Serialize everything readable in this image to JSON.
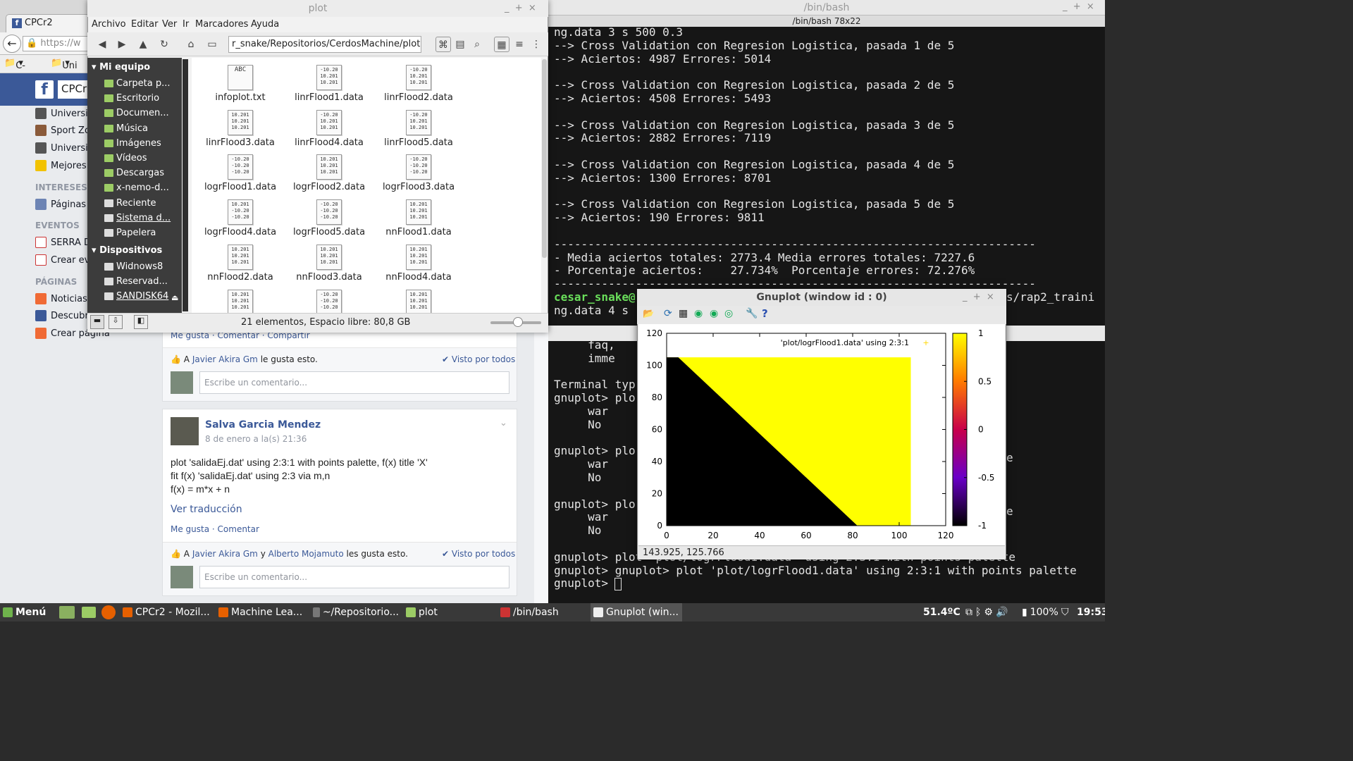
{
  "browser": {
    "tab_title": "CPCr2",
    "url": "https://w",
    "bookmarks": [
      "C-sar",
      "Uni"
    ],
    "fb_search": "CPCr",
    "sidebar": {
      "favs": [
        "Universid",
        "Sport Zor",
        "Universid",
        "Mejores a"
      ],
      "interests_head": "INTERESES",
      "interests": [
        "Páginas y"
      ],
      "events_head": "EVENTOS",
      "events": [
        "SERRA D",
        "Crear eve"
      ],
      "pages_head": "PÁGINAS",
      "pages": [
        "Noticias d",
        "Descubri",
        "Crear página"
      ]
    },
    "post1": {
      "actions": "Me gusta · Comentar · Compartir",
      "likes_prefix": "A",
      "liker": "Javier Akira Gm",
      "likes_suffix": "le gusta esto.",
      "seen": "Visto por todos",
      "comment_placeholder": "Escribe un comentario..."
    },
    "post2": {
      "author": "Salva Garcia Mendez",
      "date": "8 de enero a la(s) 21:36",
      "lines": [
        "plot 'salidaEj.dat' using 2:3:1 with points palette, f(x) title 'X'",
        "fit f(x) 'salidaEj.dat' using 2:3 via m,n",
        "f(x) = m*x + n"
      ],
      "translate": "Ver traducción",
      "actions": "Me gusta · Comentar",
      "likes_prefix": "A",
      "liker1": "Javier Akira Gm",
      "and": "y",
      "liker2": "Alberto Mojamuto",
      "likes_suffix": "les gusta esto.",
      "seen": "Visto por todos",
      "comment_placeholder": "Escribe un comentario..."
    }
  },
  "terminal": {
    "title": "/bin/bash",
    "subtitle": "/bin/bash 78x22",
    "lines": [
      "ng.data 3 s 500 0.3",
      "--> Cross Validation con Regresion Logistica, pasada 1 de 5",
      "--> Aciertos: 4987 Errores: 5014",
      "",
      "--> Cross Validation con Regresion Logistica, pasada 2 de 5",
      "--> Aciertos: 4508 Errores: 5493",
      "",
      "--> Cross Validation con Regresion Logistica, pasada 3 de 5",
      "--> Aciertos: 2882 Errores: 7119",
      "",
      "--> Cross Validation con Regresion Logistica, pasada 4 de 5",
      "--> Aciertos: 1300 Errores: 8701",
      "",
      "--> Cross Validation con Regresion Logistica, pasada 5 de 5",
      "--> Aciertos: 190 Errores: 9811",
      "",
      "-----------------------------------------------------------------------",
      "- Media aciertos totales: 2773.4 Media errores totales: 7227.6",
      "- Porcentaje aciertos:    27.734%  Porcentaje errores: 72.276%",
      "-----------------------------------------------------------------------"
    ],
    "prompt_user": "cesar_snake@",
    "prompt_tail": "s/rap2_traini",
    "line_after": "ng.data 4 s",
    "lower": [
      "     faq,",
      "     imme",
      "",
      "Terminal typ",
      "gnuplot> plo",
      "     war",
      "     No",
      "",
      "gnuplot> plo",
      "     war",
      "     No",
      "",
      "gnuplot> plo",
      "     war",
      "     No",
      "",
      "gnuplot> plot 'plot/logrFlood1.data' using 2:3:1 with points palette",
      "gnuplot> gnuplot> plot 'plot/logrFlood1.data' using 2:3:1 with points palette",
      "gnuplot> "
    ],
    "right_bits": [
      "e",
      "e"
    ]
  },
  "filemanager": {
    "title": "plot",
    "menu": [
      "Archivo",
      "Editar",
      "Ver",
      "Ir",
      "Marcadores",
      "Ayuda"
    ],
    "path": "r_snake/Repositorios/CerdosMachine/plot",
    "sidebar_head1": "Mi equipo",
    "places": [
      "Carpeta p...",
      "Escritorio",
      "Documen...",
      "Música",
      "Imágenes",
      "Vídeos",
      "Descargas",
      "x-nemo-d...",
      "Reciente",
      "Sistema d...",
      "Papelera"
    ],
    "sidebar_head2": "Dispositivos",
    "devices": [
      "Widnows8",
      "Reservad...",
      "SANDISK64"
    ],
    "files": [
      {
        "name": "infoplot.txt",
        "icon": "ABC"
      },
      {
        "name": "linrFlood1.data",
        "icon": "-10.20\n10.201\n10.201"
      },
      {
        "name": "linrFlood2.data",
        "icon": "-10.20\n10.201\n10.201"
      },
      {
        "name": "linrFlood3.data",
        "icon": "10.201\n10.201\n10.201"
      },
      {
        "name": "linrFlood4.data",
        "icon": "-10.20\n10.201\n10.201"
      },
      {
        "name": "linrFlood5.data",
        "icon": "-10.20\n10.201\n10.201"
      },
      {
        "name": "logrFlood1.data",
        "icon": "-10.20\n-10.20\n-10.20"
      },
      {
        "name": "logrFlood2.data",
        "icon": "10.201\n10.201\n10.201"
      },
      {
        "name": "logrFlood3.data",
        "icon": "-10.20\n-10.20\n-10.20"
      },
      {
        "name": "logrFlood4.data",
        "icon": "10.201\n-10.20\n-10.20"
      },
      {
        "name": "logrFlood5.data",
        "icon": "-10.20\n-10.20\n-10.20"
      },
      {
        "name": "nnFlood1.data",
        "icon": "10.201\n10.201\n10.201"
      },
      {
        "name": "nnFlood2.data",
        "icon": "10.201\n10.201\n10.201"
      },
      {
        "name": "nnFlood3.data",
        "icon": "10.201\n10.201\n10.201"
      },
      {
        "name": "nnFlood4.data",
        "icon": "10.201\n10.201\n10.201"
      },
      {
        "name": "",
        "icon": "10.201\n10.201\n10.201"
      },
      {
        "name": "",
        "icon": "-10.20\n-10.20\n-10.20"
      },
      {
        "name": "",
        "icon": "10.201\n10.201\n10.201"
      }
    ],
    "status": "21 elementos, Espacio libre: 80,8 GB"
  },
  "gnuplot": {
    "title": "Gnuplot (window id : 0)",
    "coords": "143.925,  125.766",
    "chart_data": {
      "type": "heatmap",
      "key_label": "'plot/logrFlood1.data' using 2:3:1",
      "xlim": [
        0,
        120
      ],
      "ylim": [
        0,
        120
      ],
      "xticks": [
        "0",
        "20",
        "40",
        "60",
        "80",
        "100",
        "120"
      ],
      "yticks": [
        "0",
        "20",
        "40",
        "60",
        "80",
        "100",
        "120"
      ],
      "cbrange": [
        -1,
        1
      ],
      "cbticks": [
        "1",
        "0.5",
        "0",
        "-0.5",
        "-1"
      ],
      "data_extent": {
        "x": [
          0,
          105
        ],
        "y": [
          0,
          105
        ]
      },
      "boundary": {
        "x_at_y0": 82,
        "x_at_y105": 5
      },
      "region_colors": {
        "below_line": "#000000",
        "above_line": "#ffff00"
      }
    }
  },
  "taskbar": {
    "menu": "Menú",
    "items": [
      "CPCr2 - Mozil...",
      "Machine Lea...",
      "~/Repositorio...",
      "plot",
      "/bin/bash",
      "Gnuplot (win..."
    ],
    "temp": "51.4ºC",
    "battery": "100%",
    "clock": "19:53"
  }
}
